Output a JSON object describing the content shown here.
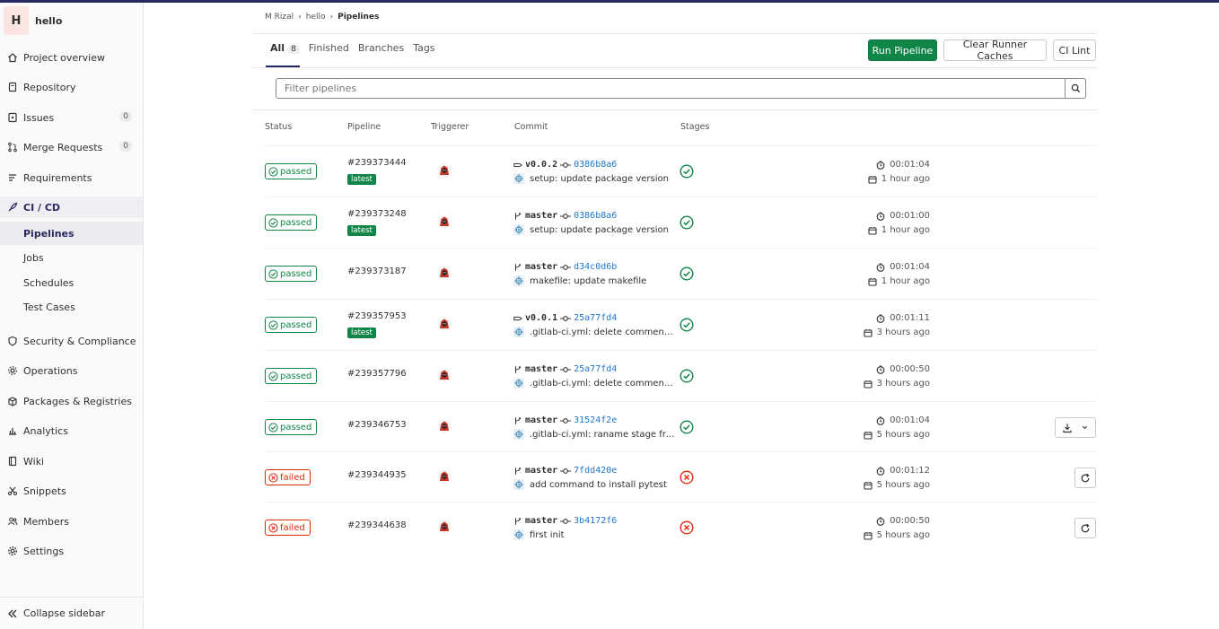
{
  "project": {
    "avatar_letter": "H",
    "name": "hello"
  },
  "sidebar": {
    "items": [
      {
        "label": "Project overview",
        "icon": "home-icon"
      },
      {
        "label": "Repository",
        "icon": "doc-icon"
      },
      {
        "label": "Issues",
        "icon": "issues-icon",
        "count": "0"
      },
      {
        "label": "Merge Requests",
        "icon": "merge-request-icon",
        "count": "0"
      },
      {
        "label": "Requirements",
        "icon": "requirements-icon"
      },
      {
        "label": "CI / CD",
        "icon": "rocket-icon",
        "active": true
      }
    ],
    "sub_items": [
      {
        "label": "Pipelines",
        "active": true
      },
      {
        "label": "Jobs"
      },
      {
        "label": "Schedules"
      },
      {
        "label": "Test Cases"
      }
    ],
    "items_after": [
      {
        "label": "Security & Compliance",
        "icon": "shield-icon"
      },
      {
        "label": "Operations",
        "icon": "cloud-gear-icon"
      },
      {
        "label": "Packages & Registries",
        "icon": "package-icon"
      },
      {
        "label": "Analytics",
        "icon": "chart-icon"
      },
      {
        "label": "Wiki",
        "icon": "book-icon"
      },
      {
        "label": "Snippets",
        "icon": "scissors-icon"
      },
      {
        "label": "Members",
        "icon": "users-icon"
      },
      {
        "label": "Settings",
        "icon": "gear-icon"
      }
    ],
    "collapse_label": "Collapse sidebar"
  },
  "breadcrumb": [
    "M Rizal",
    "hello",
    "Pipelines"
  ],
  "tabs": [
    {
      "label": "All",
      "count": "8",
      "active": true
    },
    {
      "label": "Finished"
    },
    {
      "label": "Branches"
    },
    {
      "label": "Tags"
    }
  ],
  "buttons": {
    "run_pipeline": "Run Pipeline",
    "clear_caches": "Clear Runner Caches",
    "ci_lint": "CI Lint"
  },
  "filter": {
    "placeholder": "Filter pipelines"
  },
  "columns": {
    "status": "Status",
    "pipeline": "Pipeline",
    "triggerer": "Triggerer",
    "commit": "Commit",
    "stages": "Stages"
  },
  "pipelines": [
    {
      "status": "passed",
      "id": "#239373444",
      "latest": "latest",
      "ref_type": "tag",
      "ref": "v0.0.2",
      "sha": "0386b8a6",
      "message": "setup: update package version",
      "duration": "00:01:04",
      "finished": "1 hour ago",
      "action": ""
    },
    {
      "status": "passed",
      "id": "#239373248",
      "latest": "latest",
      "ref_type": "branch",
      "ref": "master",
      "sha": "0386b8a6",
      "message": "setup: update package version",
      "duration": "00:01:00",
      "finished": "1 hour ago",
      "action": ""
    },
    {
      "status": "passed",
      "id": "#239373187",
      "latest": "",
      "ref_type": "branch",
      "ref": "master",
      "sha": "d34c0d6b",
      "message": "makefile: update makefile",
      "duration": "00:01:04",
      "finished": "1 hour ago",
      "action": ""
    },
    {
      "status": "passed",
      "id": "#239357953",
      "latest": "latest",
      "ref_type": "tag",
      "ref": "v0.0.1",
      "sha": "25a77fd4",
      "message": ".gitlab-ci.yml: delete comment;...",
      "duration": "00:01:11",
      "finished": "3 hours ago",
      "action": ""
    },
    {
      "status": "passed",
      "id": "#239357796",
      "latest": "",
      "ref_type": "branch",
      "ref": "master",
      "sha": "25a77fd4",
      "message": ".gitlab-ci.yml: delete comment;...",
      "duration": "00:00:50",
      "finished": "3 hours ago",
      "action": ""
    },
    {
      "status": "passed",
      "id": "#239346753",
      "latest": "",
      "ref_type": "branch",
      "ref": "master",
      "sha": "31524f2e",
      "message": ".gitlab-ci.yml: raname stage fro...",
      "duration": "00:01:04",
      "finished": "5 hours ago",
      "action": "download"
    },
    {
      "status": "failed",
      "id": "#239344935",
      "latest": "",
      "ref_type": "branch",
      "ref": "master",
      "sha": "7fdd420e",
      "message": "add command to install pytest",
      "duration": "00:01:12",
      "finished": "5 hours ago",
      "action": "retry"
    },
    {
      "status": "failed",
      "id": "#239344638",
      "latest": "",
      "ref_type": "branch",
      "ref": "master",
      "sha": "3b4172f6",
      "message": "first init",
      "duration": "00:00:50",
      "finished": "5 hours ago",
      "action": "retry"
    }
  ],
  "colors": {
    "accent": "#292961",
    "success": "#108548",
    "danger": "#dd2b0e",
    "link": "#1f75cb"
  }
}
